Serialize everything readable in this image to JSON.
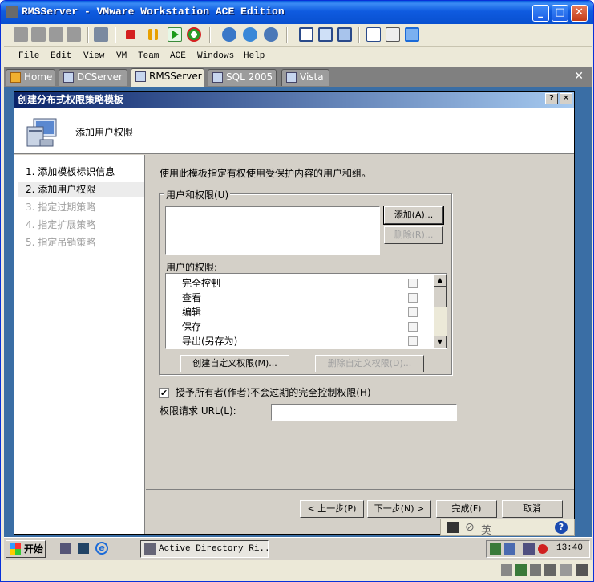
{
  "window": {
    "title": "RMSServer - VMware Workstation ACE Edition"
  },
  "menu": [
    "File",
    "Edit",
    "View",
    "VM",
    "Team",
    "ACE",
    "Windows",
    "Help"
  ],
  "tabs": [
    {
      "label": "Home",
      "icon": "home-icon"
    },
    {
      "label": "DCServer",
      "icon": "vm-icon"
    },
    {
      "label": "RMSServer",
      "icon": "vm-icon",
      "active": true
    },
    {
      "label": "SQL 2005",
      "icon": "vm-icon"
    },
    {
      "label": "Vista",
      "icon": "vm-icon"
    }
  ],
  "dialog": {
    "title": "创建分布式权限策略模板",
    "help_label": "?",
    "close_label": "✕",
    "header": "添加用户权限",
    "nav": [
      {
        "label": "1.  添加模板标识信息",
        "state": "normal"
      },
      {
        "label": "2.  添加用户权限",
        "state": "selected"
      },
      {
        "label": "3.  指定过期策略",
        "state": "disabled"
      },
      {
        "label": "4.  指定扩展策略",
        "state": "disabled"
      },
      {
        "label": "5.  指定吊销策略",
        "state": "disabled"
      }
    ],
    "description": "使用此模板指定有权使用受保护内容的用户和组。",
    "users_group_label": "用户和权限(U)",
    "add_button": "添加(A)...",
    "remove_button": "删除(R)...",
    "permissions_label": "用户的权限:",
    "permissions": [
      "完全控制",
      "查看",
      "编辑",
      "保存",
      "导出(另存为)"
    ],
    "create_custom_button": "创建自定义权限(M)...",
    "delete_custom_button": "删除自定义权限(D)...",
    "grant_owner_label": "授予所有者(作者)不会过期的完全控制权限(H)",
    "grant_owner_checked": true,
    "url_label": "权限请求 URL(L):",
    "url_value": "",
    "back_button": "< 上一步(P)",
    "next_button": "下一步(N) >",
    "finish_button": "完成(F)",
    "cancel_button": "取消"
  },
  "taskbar": {
    "start_label": "开始",
    "task_label": "Active Directory Ri...",
    "clock": "13:40",
    "lang": "英"
  }
}
